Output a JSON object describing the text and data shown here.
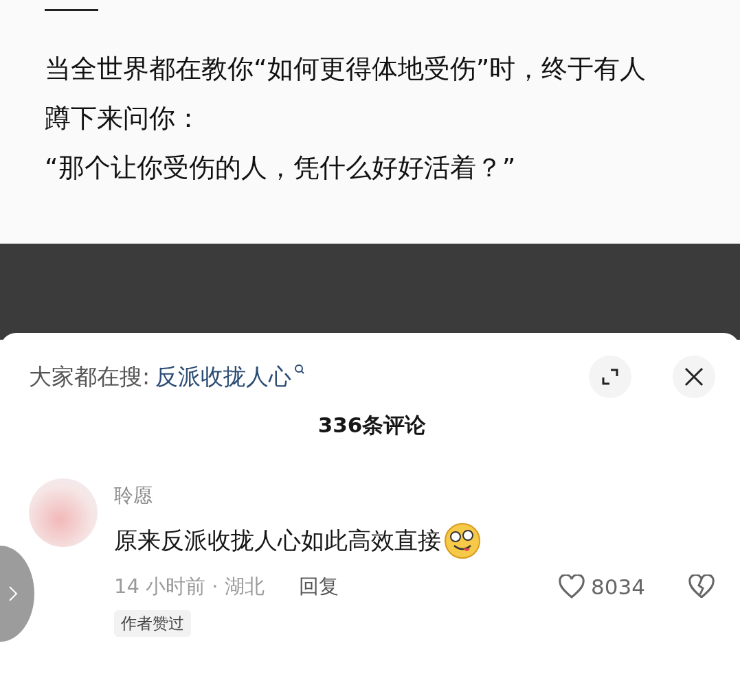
{
  "article": {
    "paragraphs": [
      "当全世界都在教你“如何更得体地受伤”时，终于有人蹲下来问你：",
      "“那个让你受伤的人，凭什么好好活着？”"
    ]
  },
  "sheet": {
    "search_prefix": "大家都在搜:",
    "search_term": "反派收拢人心",
    "comment_count": "336条评论",
    "comments": [
      {
        "user": "聆愿",
        "text": "原来反派收拢人心如此高效直接",
        "time": "14 小时前 · 湖北",
        "reply": "回复",
        "likes": "8034",
        "badge": "作者赞过"
      }
    ]
  }
}
